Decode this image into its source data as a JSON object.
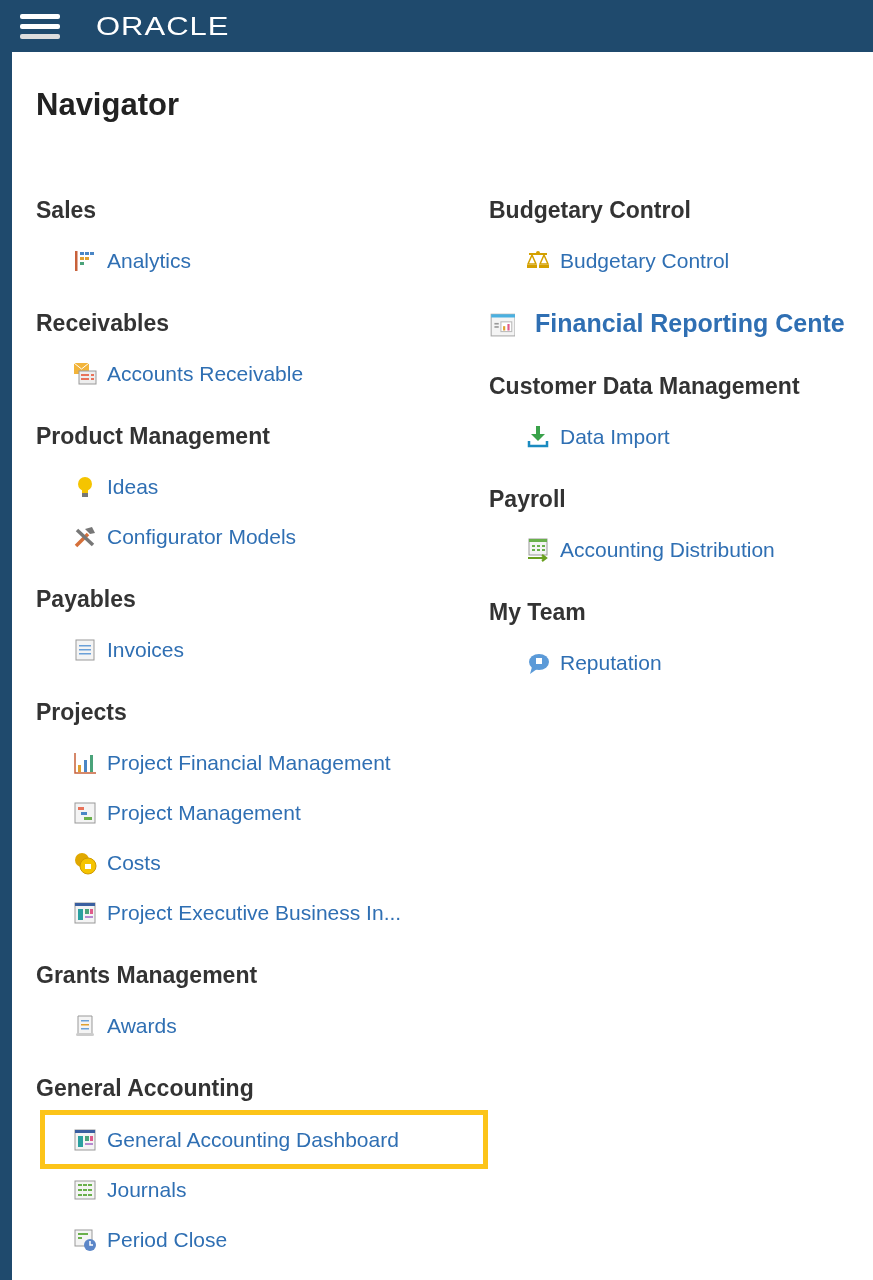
{
  "header": {
    "logo": "ORACLE"
  },
  "title": "Navigator",
  "columns": [
    {
      "groups": [
        {
          "kind": "group",
          "heading": "Sales",
          "items": [
            {
              "label": "Analytics",
              "kind": "analytics",
              "highlighted": false
            }
          ]
        },
        {
          "kind": "group",
          "heading": "Receivables",
          "items": [
            {
              "label": "Accounts Receivable",
              "kind": "mail",
              "highlighted": false
            }
          ]
        },
        {
          "kind": "group",
          "heading": "Product Management",
          "items": [
            {
              "label": "Ideas",
              "kind": "bulb",
              "highlighted": false
            },
            {
              "label": "Configurator Models",
              "kind": "tools",
              "highlighted": false
            }
          ]
        },
        {
          "kind": "group",
          "heading": "Payables",
          "items": [
            {
              "label": "Invoices",
              "kind": "document",
              "highlighted": false
            }
          ]
        },
        {
          "kind": "group",
          "heading": "Projects",
          "items": [
            {
              "label": "Project Financial Management",
              "kind": "barchart",
              "highlighted": false
            },
            {
              "label": "Project Management",
              "kind": "gantt",
              "highlighted": false
            },
            {
              "label": "Costs",
              "kind": "coins",
              "highlighted": false
            },
            {
              "label": "Project Executive Business In...",
              "kind": "dashboard",
              "highlighted": false
            }
          ]
        },
        {
          "kind": "group",
          "heading": "Grants Management",
          "items": [
            {
              "label": "Awards",
              "kind": "scroll",
              "highlighted": false
            }
          ]
        },
        {
          "kind": "group",
          "heading": "General Accounting",
          "items": [
            {
              "label": "General Accounting Dashboard",
              "kind": "dashboard",
              "highlighted": true
            },
            {
              "label": "Journals",
              "kind": "table",
              "highlighted": false
            },
            {
              "label": "Period Close",
              "kind": "clock",
              "highlighted": false
            }
          ]
        }
      ]
    },
    {
      "groups": [
        {
          "kind": "group",
          "heading": "Budgetary Control",
          "items": [
            {
              "label": "Budgetary Control",
              "kind": "scales",
              "highlighted": false
            }
          ]
        },
        {
          "kind": "link",
          "label": "Financial Reporting Cente"
        },
        {
          "kind": "group",
          "heading": "Customer Data Management",
          "items": [
            {
              "label": "Data Import",
              "kind": "download",
              "highlighted": false
            }
          ]
        },
        {
          "kind": "group",
          "heading": "Payroll",
          "items": [
            {
              "label": "Accounting Distribution",
              "kind": "distribution",
              "highlighted": false
            }
          ]
        },
        {
          "kind": "group",
          "heading": "My Team",
          "items": [
            {
              "label": "Reputation",
              "kind": "bubble",
              "highlighted": false
            }
          ]
        }
      ]
    }
  ]
}
